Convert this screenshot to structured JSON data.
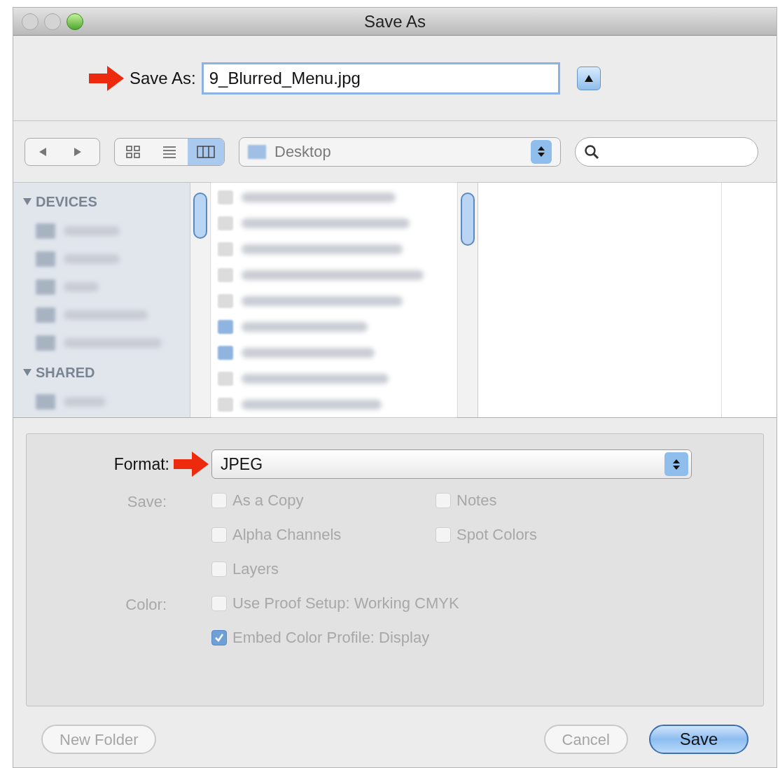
{
  "window": {
    "title": "Save As"
  },
  "save_as": {
    "label": "Save As:",
    "value": "9_Blurred_Menu.jpg",
    "expanded": false
  },
  "view_buttons": [
    {
      "kind": "icons",
      "selected": false
    },
    {
      "kind": "list",
      "selected": false
    },
    {
      "kind": "columns",
      "selected": true
    }
  ],
  "location": "Desktop",
  "sidebar": {
    "sections": [
      {
        "title": "DEVICES",
        "expanded": true
      },
      {
        "title": "SHARED",
        "expanded": true
      }
    ]
  },
  "format": {
    "label": "Format:",
    "value": "JPEG"
  },
  "save_label": "Save:",
  "save_options": [
    {
      "label": "As a Copy",
      "checked": false
    },
    {
      "label": "Notes",
      "checked": false
    },
    {
      "label": "Alpha Channels",
      "checked": false
    },
    {
      "label": "Spot Colors",
      "checked": false
    },
    {
      "label": "Layers",
      "checked": false
    }
  ],
  "color_label": "Color:",
  "color_options": [
    {
      "label": "Use Proof Setup:  Working CMYK",
      "checked": false
    },
    {
      "label": "Embed Color Profile:  Display",
      "checked": true
    }
  ],
  "buttons": [
    {
      "label": "New Folder",
      "kind": "secondary"
    },
    {
      "label": "Cancel",
      "kind": "secondary"
    },
    {
      "label": "Save",
      "kind": "default"
    }
  ]
}
